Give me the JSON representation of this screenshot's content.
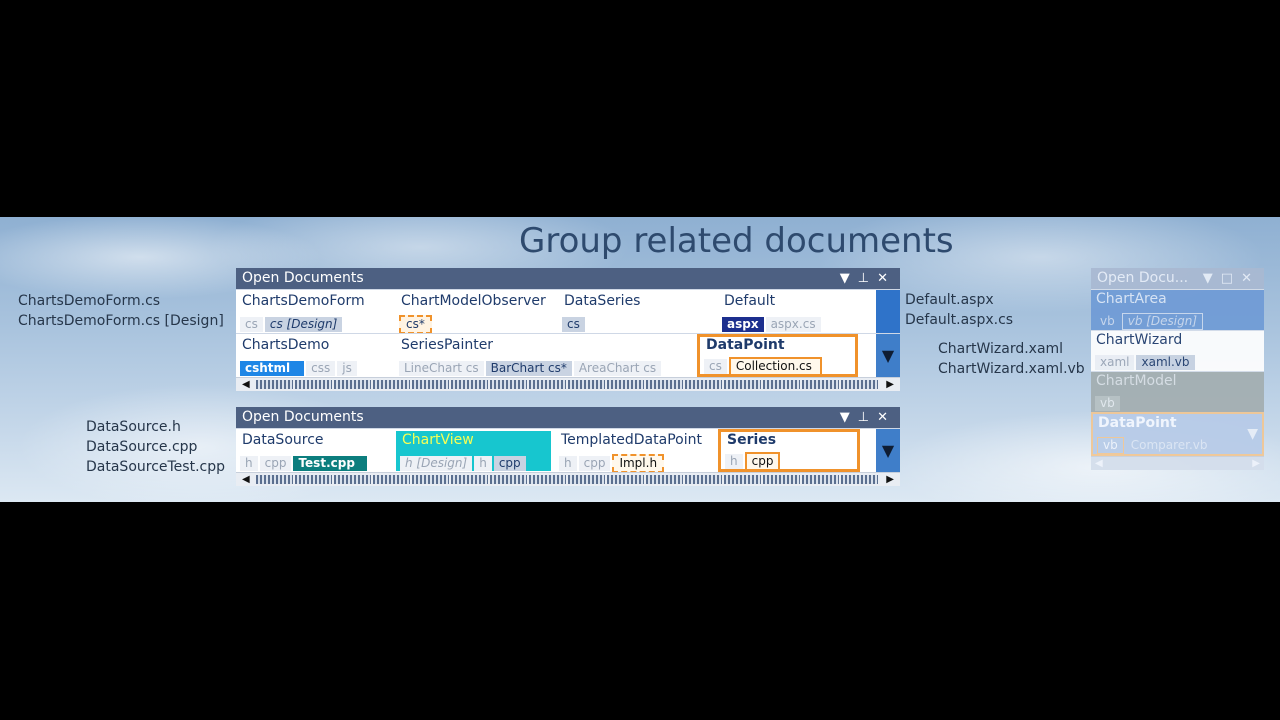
{
  "headline": "Group related documents",
  "annotations": {
    "left_top": [
      "ChartsDemoForm.cs",
      "ChartsDemoForm.cs [Design]"
    ],
    "left_bottom": [
      "DataSource.h",
      "DataSource.cpp",
      "DataSourceTest.cpp"
    ],
    "right_top": [
      "Default.aspx",
      "Default.aspx.cs"
    ],
    "right_mid": [
      "ChartWizard.xaml",
      "ChartWizard.xaml.vb"
    ]
  },
  "panel1": {
    "title": "Open Documents",
    "header_icons": [
      "chevron-down-icon",
      "pin-icon",
      "close-icon"
    ],
    "row1": [
      {
        "name": "ChartsDemoForm",
        "chips": [
          "cs",
          "cs [Design]"
        ]
      },
      {
        "name": "ChartModelObserver",
        "chips": [
          "cs*"
        ]
      },
      {
        "name": "DataSeries",
        "chips": [
          "cs"
        ]
      },
      {
        "name": "Default",
        "chips": [
          "aspx",
          "aspx.cs"
        ]
      }
    ],
    "row2": [
      {
        "name": "ChartsDemo",
        "chips": [
          "cshtml",
          "css",
          "js"
        ]
      },
      {
        "name": "SeriesPainter",
        "chips": [
          "LineChart cs",
          "BarChart cs*",
          "AreaChart cs"
        ]
      },
      {
        "name": "DataPoint",
        "chips": [
          "cs",
          "Collection.cs"
        ]
      }
    ]
  },
  "panel2": {
    "title": "Open Documents",
    "header_icons": [
      "chevron-down-icon",
      "pin-icon",
      "close-icon"
    ],
    "row1": [
      {
        "name": "DataSource",
        "chips": [
          "h",
          "cpp",
          "Test.cpp"
        ]
      },
      {
        "name": "ChartView",
        "chips": [
          "h [Design]",
          "h",
          "cpp"
        ]
      },
      {
        "name": "TemplatedDataPoint",
        "chips": [
          "h",
          "cpp",
          "Impl.h"
        ]
      },
      {
        "name": "Series",
        "chips": [
          "h",
          "cpp"
        ]
      }
    ]
  },
  "mini": {
    "title": "Open Docu...",
    "rows": [
      {
        "name": "ChartArea",
        "chips": [
          "vb",
          "vb [Design]"
        ]
      },
      {
        "name": "ChartWizard",
        "chips": [
          "xaml",
          "xaml.vb"
        ]
      },
      {
        "name": "ChartModel",
        "chips": [
          "vb"
        ]
      },
      {
        "name": "DataPoint",
        "chips": [
          "vb",
          "Comparer.vb"
        ]
      }
    ]
  },
  "colors": {
    "header": "#4d6082",
    "highlight_orange": "#f0922b",
    "dark_blue_chip": "#1c2f8e",
    "bright_blue_chip": "#1e86e6",
    "teal_chip": "#0c7e7e",
    "cyan_tab": "#17c6cf"
  }
}
